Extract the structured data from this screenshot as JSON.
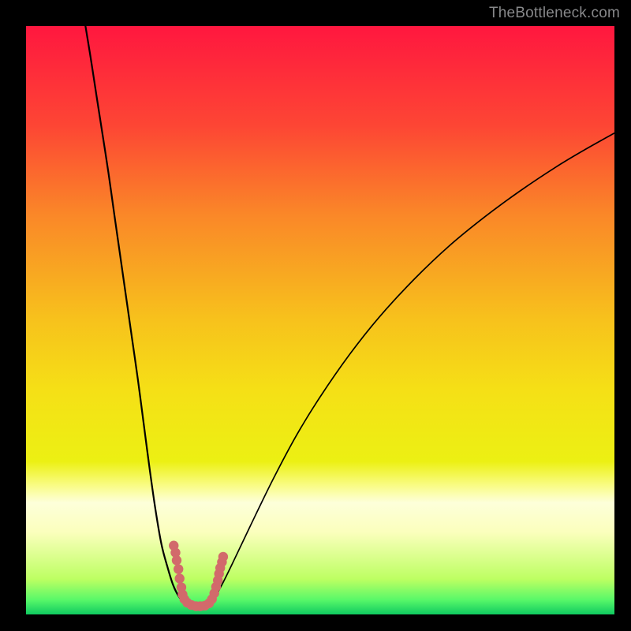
{
  "watermark": "TheBottleneck.com",
  "chart_data": {
    "type": "line",
    "title": "",
    "xlabel": "",
    "ylabel": "",
    "xlim": [
      0,
      100
    ],
    "ylim": [
      0,
      100
    ],
    "background_gradient": {
      "direction": "vertical",
      "stops": [
        {
          "pos": 0.0,
          "color": "#ff173f"
        },
        {
          "pos": 0.17,
          "color": "#fd4634"
        },
        {
          "pos": 0.32,
          "color": "#fa8728"
        },
        {
          "pos": 0.5,
          "color": "#f7c21c"
        },
        {
          "pos": 0.62,
          "color": "#f5e016"
        },
        {
          "pos": 0.74,
          "color": "#ecf013"
        },
        {
          "pos": 0.78,
          "color": "#f9fc83"
        },
        {
          "pos": 0.81,
          "color": "#fdffda"
        },
        {
          "pos": 0.86,
          "color": "#fbffbd"
        },
        {
          "pos": 0.94,
          "color": "#bdff62"
        },
        {
          "pos": 0.975,
          "color": "#59f869"
        },
        {
          "pos": 1.0,
          "color": "#0fca60"
        }
      ]
    },
    "series": [
      {
        "name": "left-curve",
        "x": [
          10.1,
          11,
          12,
          13,
          14,
          15,
          16,
          17,
          18,
          19,
          20,
          21,
          22,
          23,
          24,
          25,
          26,
          26.9
        ],
        "y": [
          100,
          94.5,
          88,
          81.6,
          75.1,
          68,
          61,
          54,
          47,
          40,
          32.4,
          24.8,
          17.8,
          12,
          8.2,
          5,
          3,
          2.1
        ]
      },
      {
        "name": "right-curve",
        "x": [
          31.5,
          33,
          35,
          38,
          42,
          46,
          50,
          55,
          60,
          66,
          72,
          78,
          84,
          90,
          95,
          100
        ],
        "y": [
          2.1,
          4.5,
          8.5,
          14.8,
          23,
          30.5,
          37,
          44.2,
          50.5,
          57,
          62.7,
          67.6,
          72,
          76,
          79,
          81.8
        ]
      },
      {
        "name": "trough",
        "x": [
          26.9,
          27.4,
          28,
          29,
          30,
          30.8,
          31.5
        ],
        "y": [
          2.1,
          1.7,
          1.5,
          1.4,
          1.5,
          1.7,
          2.1
        ]
      }
    ],
    "markers": {
      "name": "highlighted-points",
      "color": "#d26a6b",
      "points": [
        {
          "x": 25.1,
          "y": 11.7
        },
        {
          "x": 25.4,
          "y": 10.5
        },
        {
          "x": 25.6,
          "y": 9.2
        },
        {
          "x": 25.9,
          "y": 7.7
        },
        {
          "x": 26.1,
          "y": 6.1
        },
        {
          "x": 26.4,
          "y": 4.6
        },
        {
          "x": 26.6,
          "y": 3.4
        },
        {
          "x": 26.9,
          "y": 2.6
        },
        {
          "x": 27.4,
          "y": 2.0
        },
        {
          "x": 28.1,
          "y": 1.6
        },
        {
          "x": 28.9,
          "y": 1.4
        },
        {
          "x": 29.6,
          "y": 1.4
        },
        {
          "x": 30.4,
          "y": 1.5
        },
        {
          "x": 31.1,
          "y": 1.9
        },
        {
          "x": 31.6,
          "y": 2.6
        },
        {
          "x": 32.0,
          "y": 3.6
        },
        {
          "x": 32.3,
          "y": 4.7
        },
        {
          "x": 32.6,
          "y": 5.8
        },
        {
          "x": 32.8,
          "y": 6.9
        },
        {
          "x": 33.0,
          "y": 7.9
        },
        {
          "x": 33.3,
          "y": 8.9
        },
        {
          "x": 33.5,
          "y": 9.8
        }
      ]
    }
  }
}
